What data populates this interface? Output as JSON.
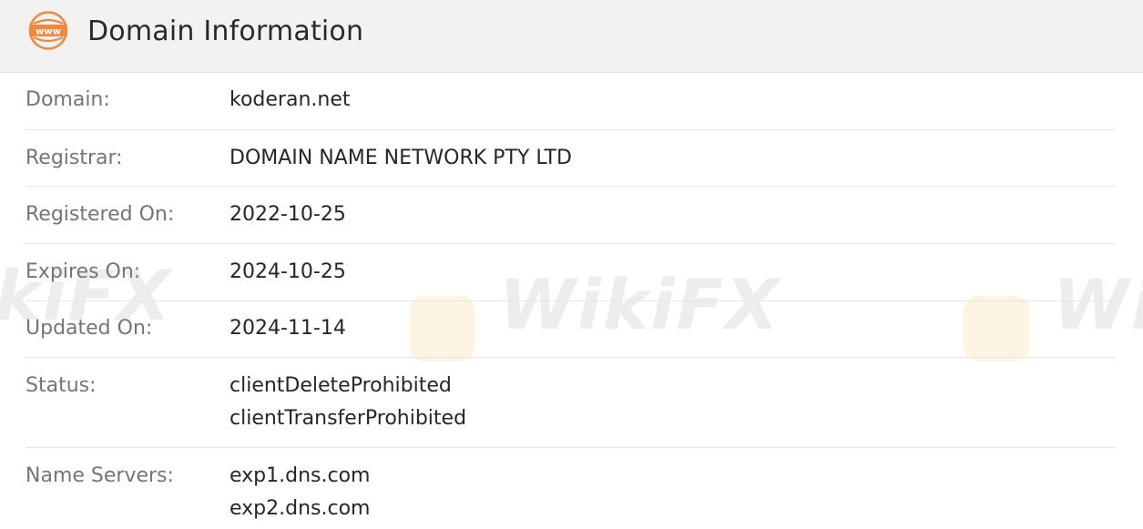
{
  "header": {
    "icon": "www-globe-icon",
    "title": "Domain Information",
    "accent": "#f0883e"
  },
  "watermark": {
    "text": "WikiFX"
  },
  "rows": [
    {
      "label": "Domain:",
      "values": [
        "koderan.net"
      ]
    },
    {
      "label": "Registrar:",
      "values": [
        "DOMAIN NAME NETWORK PTY LTD"
      ]
    },
    {
      "label": "Registered On:",
      "values": [
        "2022-10-25"
      ]
    },
    {
      "label": "Expires On:",
      "values": [
        "2024-10-25"
      ]
    },
    {
      "label": "Updated On:",
      "values": [
        "2024-11-14"
      ]
    },
    {
      "label": "Status:",
      "values": [
        "clientDeleteProhibited",
        "clientTransferProhibited"
      ]
    },
    {
      "label": "Name Servers:",
      "values": [
        "exp1.dns.com",
        "exp2.dns.com"
      ]
    }
  ]
}
